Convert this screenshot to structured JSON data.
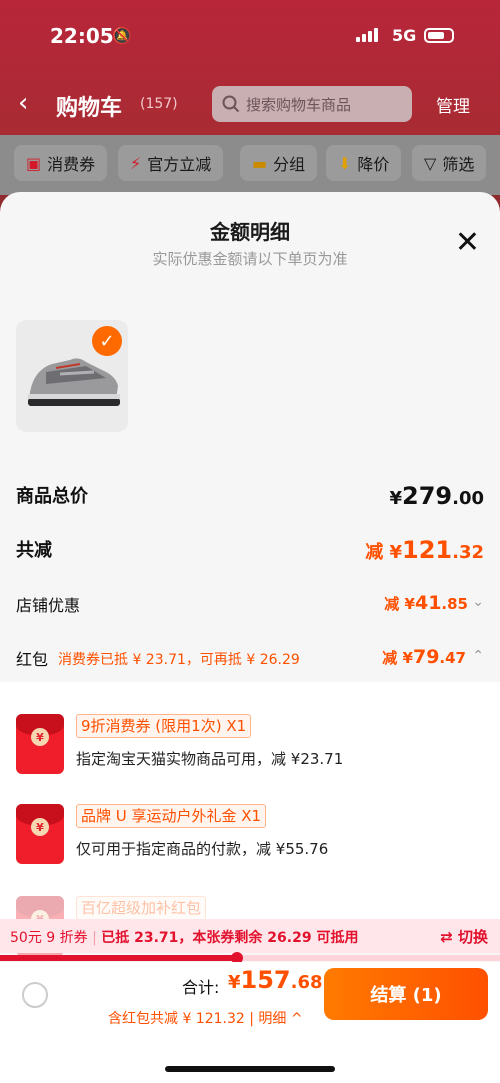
{
  "status": {
    "time": "22:05",
    "network": "5G"
  },
  "header": {
    "title": "购物车",
    "count": "(157)",
    "search_placeholder": "搜索购物车商品",
    "manage": "管理"
  },
  "filters": [
    {
      "label": "消费券",
      "icon": "coupon-icon"
    },
    {
      "label": "官方立减",
      "icon": "lightning-icon"
    },
    {
      "label": "分组",
      "icon": "folder-icon"
    },
    {
      "label": "降价",
      "icon": "price-drop-icon"
    },
    {
      "label": "筛选",
      "icon": "filter-icon"
    }
  ],
  "sheet": {
    "title": "金额明细",
    "subtitle": "实际优惠金额请以下单页为准",
    "rows": {
      "total": {
        "label": "商品总价",
        "prefix": "¥",
        "int": "279",
        "dec": ".00"
      },
      "reduce": {
        "label": "共减",
        "prefix": "减 ¥",
        "int": "121",
        "dec": ".32"
      },
      "shop": {
        "label": "店铺优惠",
        "prefix": "减 ¥",
        "int": "41",
        "dec": ".85"
      },
      "redpack": {
        "label": "红包",
        "tip": "消费券已抵 ¥ 23.71，可再抵 ¥ 26.29",
        "prefix": "减 ¥",
        "int": "79",
        "dec": ".47"
      }
    },
    "coupons": [
      {
        "tag": "9折消费券 (限用1次) X1",
        "desc": "指定淘宝天猫实物商品可用，减 ¥23.71"
      },
      {
        "tag": "品牌 U 享运动户外礼金 X1",
        "desc": "仅可用于指定商品的付款，减 ¥55.76"
      },
      {
        "tag": "百亿超级加补红包",
        "desc": ""
      }
    ]
  },
  "progress": {
    "left": "50元 9 折券",
    "right": "已抵 23.71，本张券剩余 26.29 可抵用",
    "switch": "⇄ 切换",
    "fraction": 0.474
  },
  "footer": {
    "total_label": "合计:",
    "total_prefix": "¥",
    "total_int": "157",
    "total_dec": ".68",
    "sub": "含红包共减 ¥ 121.32 | 明细 ^",
    "checkout": "结算 (1)"
  }
}
